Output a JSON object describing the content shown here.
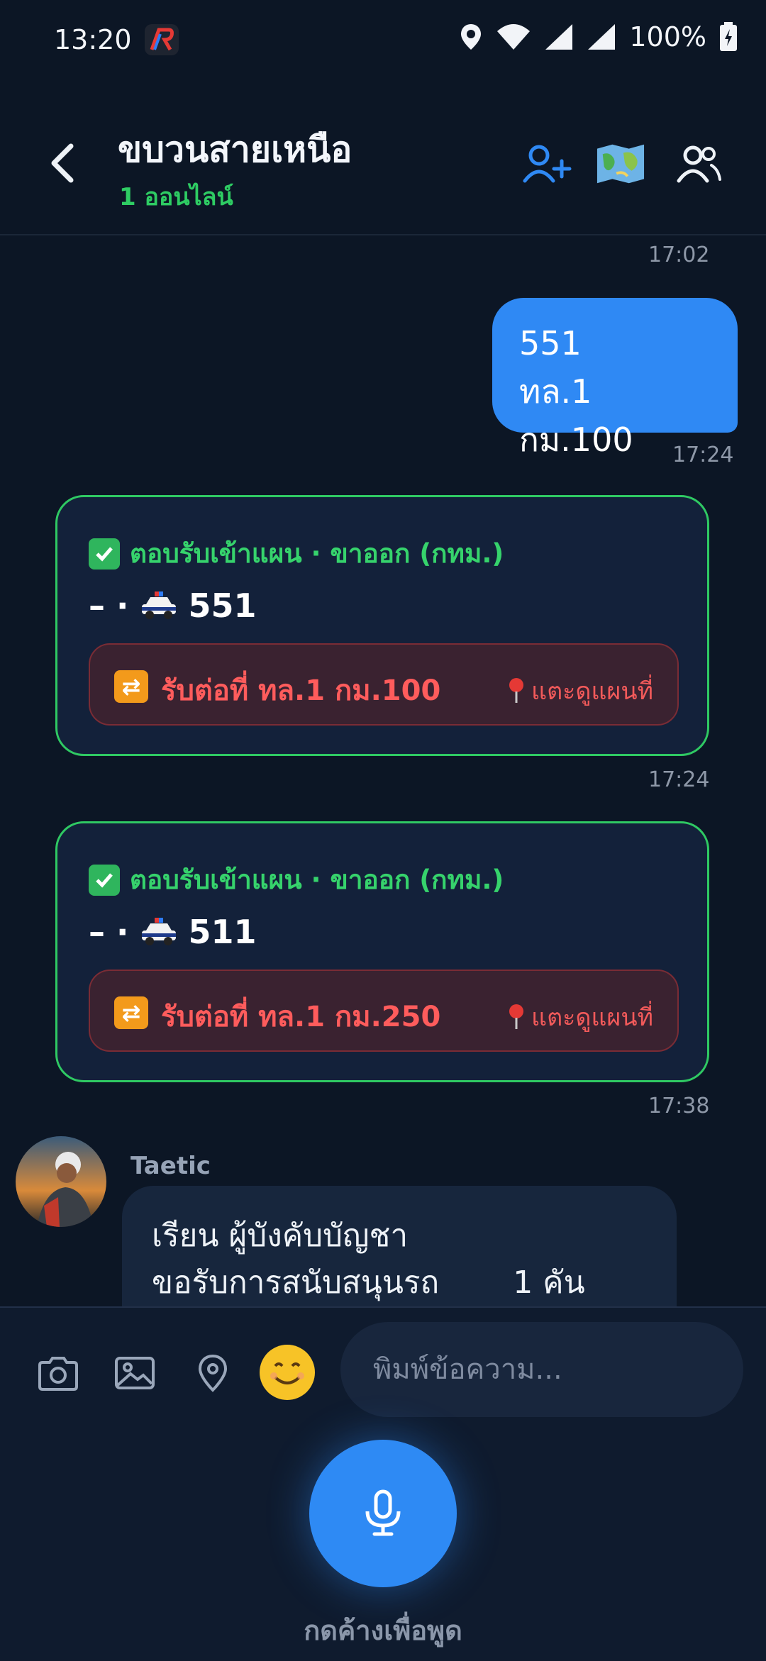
{
  "status_bar": {
    "time": "13:20",
    "battery": "100%"
  },
  "header": {
    "title": "ขบวนสายเหนือ",
    "subtitle": "1 ออนไลน์",
    "accent_online": "#2ecc63"
  },
  "messages": {
    "ts1": "17:02",
    "out": {
      "line1": "551",
      "line2": "ทล.1 กม.100",
      "time": "17:24"
    },
    "card1": {
      "header": "ตอบรับเข้าแผน · ขาออก (กทม.)",
      "unit_prefix": "– ·",
      "unit": "551",
      "pickup": "รับต่อที่ ทล.1 กม.100",
      "map_link": "แตะดูแผนที่",
      "time": "17:24"
    },
    "card2": {
      "header": "ตอบรับเข้าแผน · ขาออก (กทม.)",
      "unit_prefix": "– ·",
      "unit": "511",
      "pickup": "รับต่อที่ ทล.1 กม.250",
      "map_link": "แตะดูแผนที่",
      "time": "17:38"
    },
    "incoming": {
      "sender": "Taetic",
      "line1": "เรียน ผู้บังคับบัญชา",
      "line2": "ขอรับการสนับสนุนรถ",
      "line2_end": "1 คัน"
    }
  },
  "composer": {
    "placeholder": "พิมพ์ข้อความ...",
    "hold_to_talk": "กดค้างเพื่อพูด"
  },
  "icons": [
    "camera-icon",
    "image-icon",
    "location-icon",
    "emoji-icon",
    "microphone-icon",
    "add-user-icon",
    "map-icon",
    "members-icon",
    "back-icon"
  ]
}
